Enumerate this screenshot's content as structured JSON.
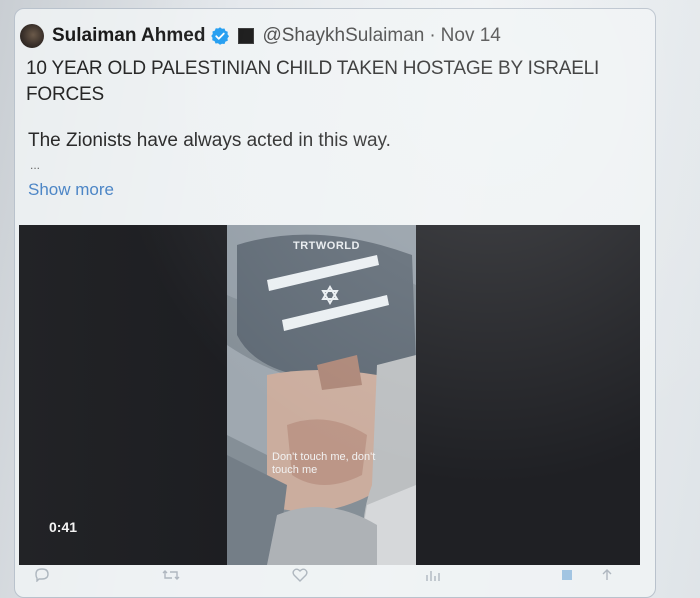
{
  "tweet": {
    "display_name": "Sulaiman Ahmed",
    "handle": "@ShaykhSulaiman",
    "separator": "·",
    "date": "Nov 14",
    "headline": "10 YEAR OLD PALESTINIAN CHILD TAKEN HOSTAGE BY ISRAELI FORCES",
    "body": "The Zionists have always acted in this way.",
    "ellipsis": "...",
    "show_more_label": "Show more",
    "icons": {
      "avatar": "avatar",
      "verified": "verified-badge-icon",
      "flag": "black-square-flag-icon"
    }
  },
  "media": {
    "watermark": "TRTWORLD",
    "caption": "Don't touch me, don't touch me",
    "duration": "0:41"
  },
  "actions": {
    "reply_icon": "reply-icon",
    "retweet_icon": "retweet-icon",
    "like_icon": "heart-icon",
    "views_icon": "views-icon",
    "bookmark_icon": "bookmark-icon",
    "share_icon": "share-icon"
  },
  "colors": {
    "link": "#4d86c6",
    "verified": "#1d9bf0",
    "text": "#262626"
  }
}
